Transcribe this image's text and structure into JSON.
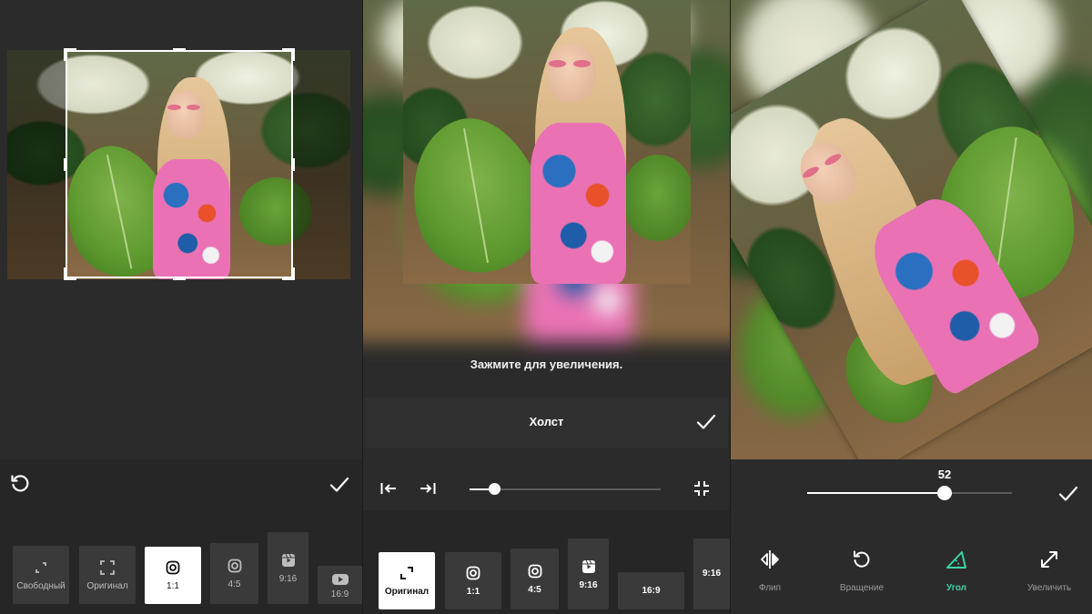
{
  "crop_panel": {
    "ratios": [
      {
        "label": "Свободный",
        "icon": "free-crop-icon",
        "active": false
      },
      {
        "label": "Оригинал",
        "icon": "original-frame-icon",
        "active": false
      },
      {
        "label": "1:1",
        "icon": "instagram-icon",
        "active": true
      },
      {
        "label": "4:5",
        "icon": "instagram-icon",
        "active": false
      },
      {
        "label": "9:16",
        "icon": "reels-icon",
        "active": false
      },
      {
        "label": "16:9",
        "icon": "youtube-icon",
        "active": false
      }
    ]
  },
  "canvas_panel": {
    "hint": "Зажмите для увеличения.",
    "title": "Холст",
    "slider_value": 0.13,
    "ratios": [
      {
        "label": "Оригинал",
        "icon": "expand-corners-icon",
        "active": true
      },
      {
        "label": "1:1",
        "icon": "instagram-icon",
        "active": false
      },
      {
        "label": "4:5",
        "icon": "instagram-icon",
        "active": false
      },
      {
        "label": "9:16",
        "icon": "reels-icon",
        "active": false
      },
      {
        "label": "16:9",
        "icon": "",
        "active": false
      },
      {
        "label": "9:16",
        "icon": "",
        "active": false
      }
    ]
  },
  "rotate_panel": {
    "angle": "52",
    "slider_value": 0.67,
    "tools": [
      {
        "label": "Флип",
        "icon": "flip-icon",
        "active": false
      },
      {
        "label": "Вращение",
        "icon": "rotate-icon",
        "active": false
      },
      {
        "label": "Угол",
        "icon": "angle-icon",
        "active": true
      },
      {
        "label": "Увеличить",
        "icon": "zoom-icon",
        "active": false
      }
    ]
  },
  "colors": {
    "accent": "#3ad4a8",
    "panel_bg": "#2b2b2b",
    "button_bg": "#3a3a3a",
    "active_bg": "#ffffff"
  }
}
